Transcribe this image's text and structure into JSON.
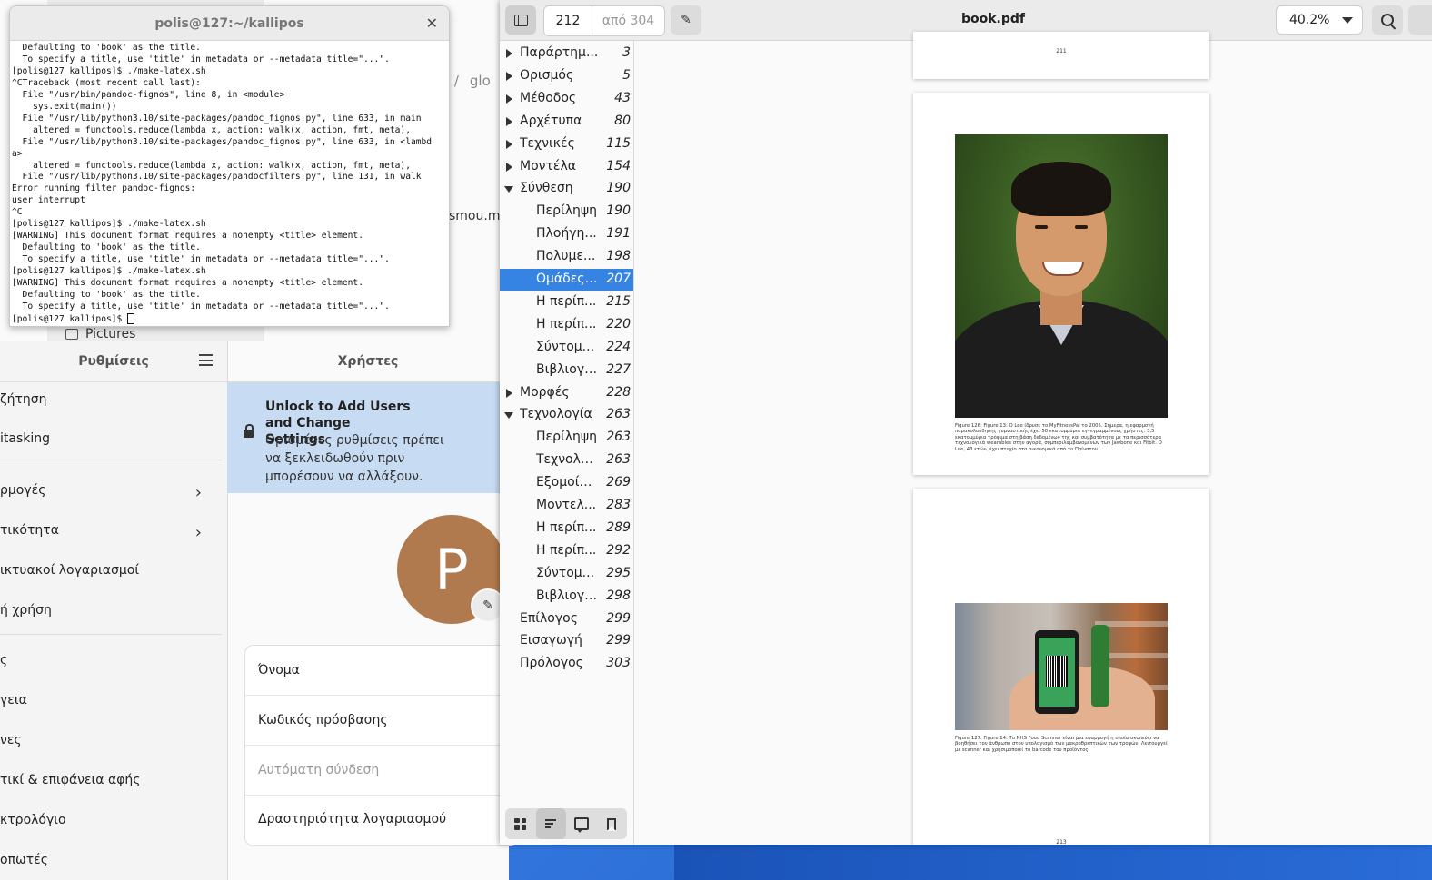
{
  "file_manager": {
    "crumb_partial_1": "s",
    "crumb_partial_2": "glo",
    "partial_filename": "smou.m",
    "sidebar_pictures": "Pictures"
  },
  "terminal": {
    "title": "polis@127:~/kallipos",
    "lines": [
      "  Defaulting to 'book' as the title.",
      "  To specify a title, use 'title' in metadata or --metadata title=\"...\".",
      "[polis@127 kallipos]$ ./make-latex.sh",
      "^CTraceback (most recent call last):",
      "  File \"/usr/bin/pandoc-fignos\", line 8, in <module>",
      "    sys.exit(main())",
      "  File \"/usr/lib/python3.10/site-packages/pandoc_fignos.py\", line 633, in main",
      "    altered = functools.reduce(lambda x, action: walk(x, action, fmt, meta),",
      "  File \"/usr/lib/python3.10/site-packages/pandoc_fignos.py\", line 633, in <lambd",
      "a>",
      "    altered = functools.reduce(lambda x, action: walk(x, action, fmt, meta),",
      "  File \"/usr/lib/python3.10/site-packages/pandocfilters.py\", line 131, in walk",
      "Error running filter pandoc-fignos:",
      "user interrupt",
      "^C",
      "[polis@127 kallipos]$ ./make-latex.sh",
      "[WARNING] This document format requires a nonempty <title> element.",
      "  Defaulting to 'book' as the title.",
      "  To specify a title, use 'title' in metadata or --metadata title=\"...\".",
      "[polis@127 kallipos]$ ./make-latex.sh",
      "[WARNING] This document format requires a nonempty <title> element.",
      "  Defaulting to 'book' as the title.",
      "  To specify a title, use 'title' in metadata or --metadata title=\"...\".",
      "[polis@127 kallipos]$ "
    ]
  },
  "settings": {
    "sidebar_title": "Ρυθμίσεις",
    "sidebar_items": [
      {
        "label": "ζήτηση",
        "chevron": false
      },
      {
        "label": "itasking",
        "chevron": false
      },
      {
        "label": "ρμογές",
        "chevron": true
      },
      {
        "label": "τικότητα",
        "chevron": true
      },
      {
        "label": "ικτυακοί λογαριασμοί",
        "chevron": false
      },
      {
        "label": "ή χρήση",
        "chevron": false
      },
      {
        "label": "ς",
        "chevron": false
      },
      {
        "label": "γεια",
        "chevron": false
      },
      {
        "label": "νες",
        "chevron": false
      },
      {
        "label": "τικί & επιφάνεια αφής",
        "chevron": false
      },
      {
        "label": "κτρολόγιο",
        "chevron": false
      },
      {
        "label": "οπωτές",
        "chevron": false
      }
    ],
    "main_title": "Χρήστες",
    "unlock_title": "Unlock to Add Users and Change Settings",
    "unlock_desc": "Ορισμένες ρυθμίσεις πρέπει να ξεκλειδωθούν πριν μπορέσουν να αλλάξουν.",
    "avatar_letter": "P",
    "avatar_color": "#b07a4e",
    "account_rows": [
      "Όνομα",
      "Κωδικός πρόσβασης",
      "Αυτόματη σύνδεση",
      "Δραστηριότητα λογαριασμού"
    ]
  },
  "pdf": {
    "current_page": "212",
    "of_pages": "από 304",
    "title": "book.pdf",
    "zoom": "40.2%",
    "accent": "#3584e4",
    "outline": [
      {
        "label": "Παράρτημ...",
        "page": "3",
        "level": 0,
        "expander": "closed"
      },
      {
        "label": "Ορισμός",
        "page": "5",
        "level": 0,
        "expander": "closed"
      },
      {
        "label": "Μέθοδος",
        "page": "43",
        "level": 0,
        "expander": "closed"
      },
      {
        "label": "Αρχέτυπα",
        "page": "80",
        "level": 0,
        "expander": "closed"
      },
      {
        "label": "Τεχνικές",
        "page": "115",
        "level": 0,
        "expander": "closed"
      },
      {
        "label": "Μοντέλα",
        "page": "154",
        "level": 0,
        "expander": "closed"
      },
      {
        "label": "Σύνθεση",
        "page": "190",
        "level": 0,
        "expander": "open"
      },
      {
        "label": "Περίληψη",
        "page": "190",
        "level": 1,
        "expander": "none"
      },
      {
        "label": "Πλοήγη...",
        "page": "191",
        "level": 1,
        "expander": "none"
      },
      {
        "label": "Πολυμε...",
        "page": "198",
        "level": 1,
        "expander": "none"
      },
      {
        "label": "Ομάδες ...",
        "page": "207",
        "level": 1,
        "expander": "none",
        "selected": true
      },
      {
        "label": "Η περίπ...",
        "page": "215",
        "level": 1,
        "expander": "none"
      },
      {
        "label": "Η περίπ...",
        "page": "220",
        "level": 1,
        "expander": "none"
      },
      {
        "label": "Σύντομ...",
        "page": "224",
        "level": 1,
        "expander": "none"
      },
      {
        "label": "Βιβλιογρ...",
        "page": "227",
        "level": 1,
        "expander": "none"
      },
      {
        "label": "Μορφές",
        "page": "228",
        "level": 0,
        "expander": "closed"
      },
      {
        "label": "Τεχνολογία",
        "page": "263",
        "level": 0,
        "expander": "open"
      },
      {
        "label": "Περίληψη",
        "page": "263",
        "level": 1,
        "expander": "none"
      },
      {
        "label": "Τεχνολο...",
        "page": "263",
        "level": 1,
        "expander": "none"
      },
      {
        "label": "Εξομοίω...",
        "page": "269",
        "level": 1,
        "expander": "none"
      },
      {
        "label": "Μοντελ...",
        "page": "283",
        "level": 1,
        "expander": "none"
      },
      {
        "label": "Η περίπ...",
        "page": "289",
        "level": 1,
        "expander": "none"
      },
      {
        "label": "Η περίπ...",
        "page": "292",
        "level": 1,
        "expander": "none"
      },
      {
        "label": "Σύντομ...",
        "page": "295",
        "level": 1,
        "expander": "none"
      },
      {
        "label": "Βιβλιογρ...",
        "page": "298",
        "level": 1,
        "expander": "none"
      },
      {
        "label": "Επίλογος",
        "page": "299",
        "level": 0,
        "expander": "none"
      },
      {
        "label": "Εισαγωγή",
        "page": "299",
        "level": 0,
        "expander": "none"
      },
      {
        "label": "Πρόλογος",
        "page": "303",
        "level": 0,
        "expander": "none"
      }
    ],
    "pages": {
      "p211_num": "211",
      "p212_caption": "Figure 126: Figure 13: Ο Lee ίδρυσε το MyFitnessPal το 2005. Σήμερα, η εφαρμογή παρακολούθησης γυμναστικής έχει 50 εκατομμύρια εγγεγραμμένους χρήστες. 3,5 εκατομμύρια τρόφιμα στη βάση δεδομένων της και συμβατότητα με τα περισσότερα τεχνολογικά wearables στην αγορά, συμπεριλαμβανομένων των Jawbone και Fitbit. Ο Lee, 43 ετών, έχει πτυχίο στα οικονομικά από το Πρίνστον.",
      "p213_caption": "Figure 127: Figure 14: Το NHS Food Scanner είναι μια εφαρμογή η οποία σκοπεύει να βοηθήσει τον άνθρωπο στον υπολογισμό των μακροθρεπτικών των τροφών. Λειτουργεί με scanner και χρησιμοποιεί το barcode του προϊόντος.",
      "p213_num": "213"
    }
  }
}
